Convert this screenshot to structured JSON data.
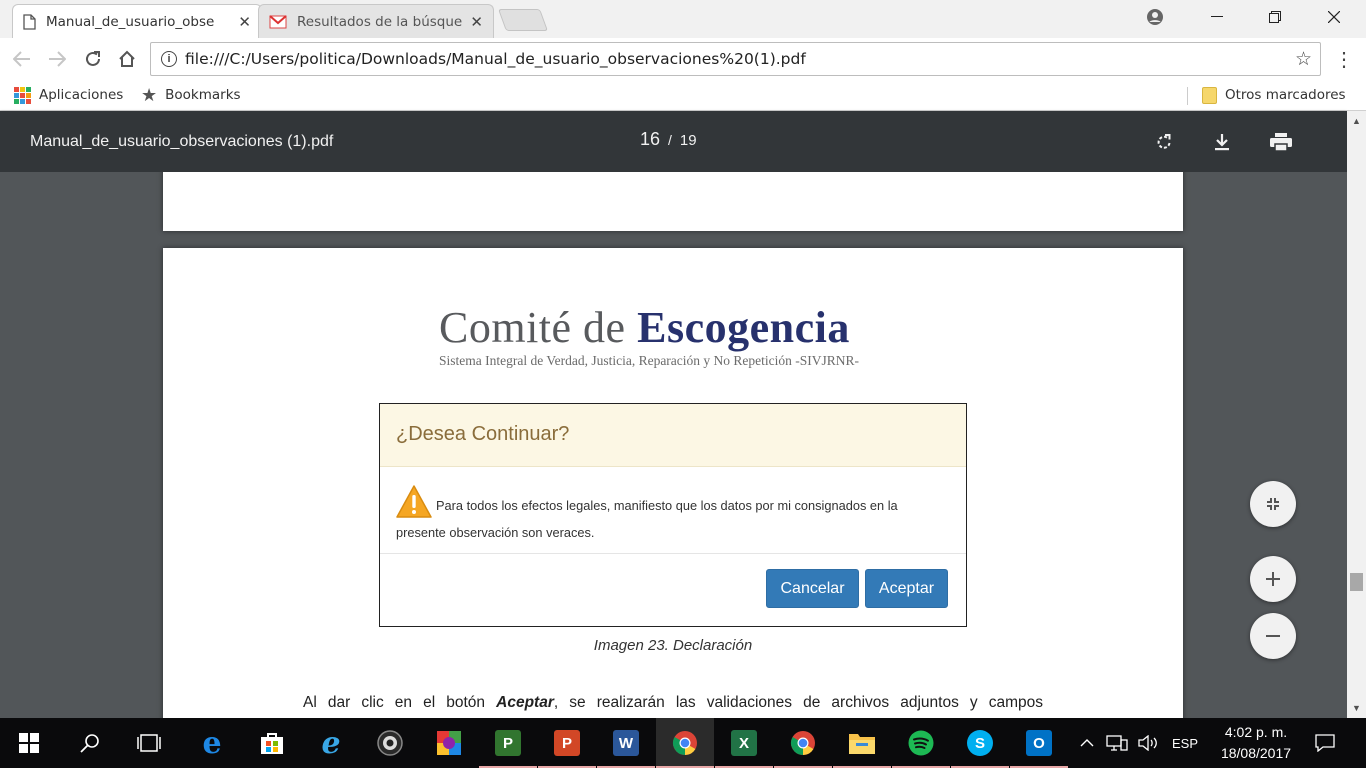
{
  "browser": {
    "tabs": [
      {
        "title": "Manual_de_usuario_obse",
        "close": "✕"
      },
      {
        "title": "Resultados de la búsqued",
        "close": "✕"
      }
    ],
    "url": "file:///C:/Users/politica/Downloads/Manual_de_usuario_observaciones%20(1).pdf",
    "bookmarks": {
      "apps": "Aplicaciones",
      "bookmarks": "Bookmarks",
      "other": "Otros marcadores"
    }
  },
  "pdf": {
    "file_name": "Manual_de_usuario_observaciones (1).pdf",
    "current_page": "16",
    "separator": "/",
    "total_pages": "19"
  },
  "document": {
    "logo": {
      "part1": "Comité de ",
      "part2": "Escogencia",
      "subtitle": "Sistema Integral de Verdad, Justicia, Reparación y No Repetición -SIVJRNR-"
    },
    "dialog": {
      "title": "¿Desea Continuar?",
      "message_line1": "Para todos los efectos legales, manifiesto que los datos por mi consignados en la",
      "message_line2": "presente observación son veraces.",
      "cancel": "Cancelar",
      "accept": "Aceptar"
    },
    "caption": "Imagen 23. Declaración",
    "paragraph_start": "Al dar clic en el botón ",
    "paragraph_bold": "Aceptar",
    "paragraph_end": ", se realizarán las validaciones de archivos adjuntos y campos"
  },
  "taskbar": {
    "language": "ESP",
    "time": "4:02 p. m.",
    "date": "18/08/2017"
  },
  "colors": {
    "pdf_toolbar": "#323639",
    "viewer_bg": "#525659",
    "logo_blue": "#27316d",
    "dialog_header": "#fcf7e4",
    "button_blue": "#337ab7",
    "taskbar": "#0a0a0c"
  }
}
